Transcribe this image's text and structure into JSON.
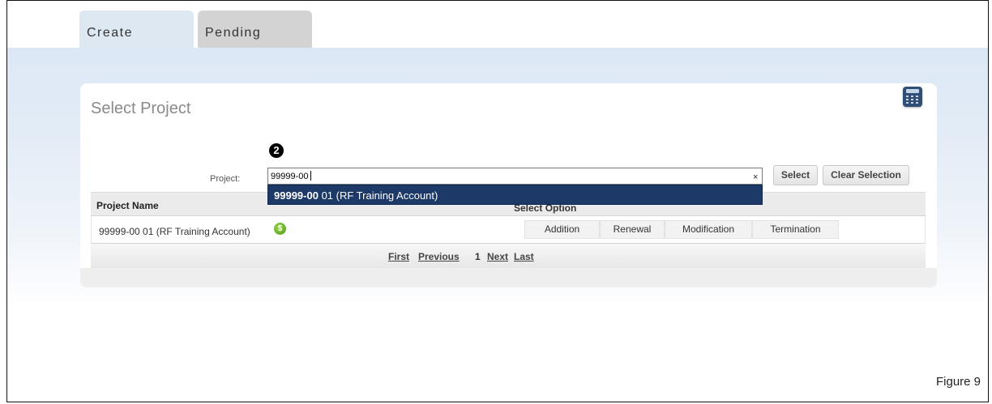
{
  "tabs": [
    {
      "label": "Create"
    },
    {
      "label": "Pending"
    }
  ],
  "card": {
    "title": "Select Project",
    "step_marker": "2"
  },
  "form": {
    "project_label": "Project:",
    "project_value": "99999-00",
    "clear_glyph": "×",
    "select_button": "Select",
    "clear_selection_button": "Clear Selection"
  },
  "autocomplete": {
    "match": "99999-00",
    "rest": " 01 (RF Training Account)"
  },
  "table": {
    "headers": {
      "name": "Project Name",
      "options": "Select Option"
    },
    "rows": [
      {
        "name": "99999-00 01 (RF Training Account)",
        "status_icon": "dollar-icon",
        "status_glyph": "$",
        "options": [
          "Addition",
          "Renewal",
          "Modification",
          "Termination"
        ]
      }
    ]
  },
  "pager": {
    "first": "First",
    "previous": "Previous",
    "current": "1",
    "next": "Next",
    "last": "Last"
  },
  "figure_label": "Figure 9",
  "colors": {
    "dropdown_bg": "#1d3968",
    "tab_active": "#dde8f3",
    "tab_inactive": "#d4d3d4",
    "status_icon": "#5aa829"
  },
  "icons": {
    "calculator": "calculator-icon"
  }
}
